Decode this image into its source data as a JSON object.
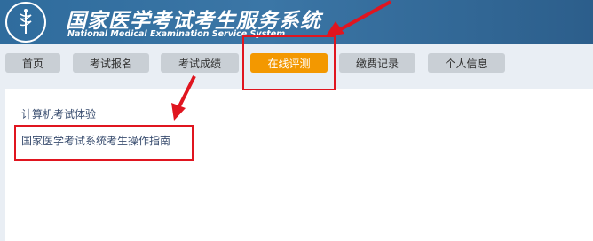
{
  "header": {
    "title": "国家医学考试考生服务系统",
    "subtitle": "National Medical Examination Service System"
  },
  "nav": {
    "items": [
      {
        "label": "首页"
      },
      {
        "label": "考试报名"
      },
      {
        "label": "考试成绩"
      },
      {
        "label": "在线评测",
        "active": true
      },
      {
        "label": "缴费记录"
      },
      {
        "label": "个人信息"
      }
    ]
  },
  "content": {
    "link1": "计算机考试体验",
    "link2": "国家医学考试系统考生操作指南"
  },
  "annotation": {
    "color": "#e0151f"
  }
}
